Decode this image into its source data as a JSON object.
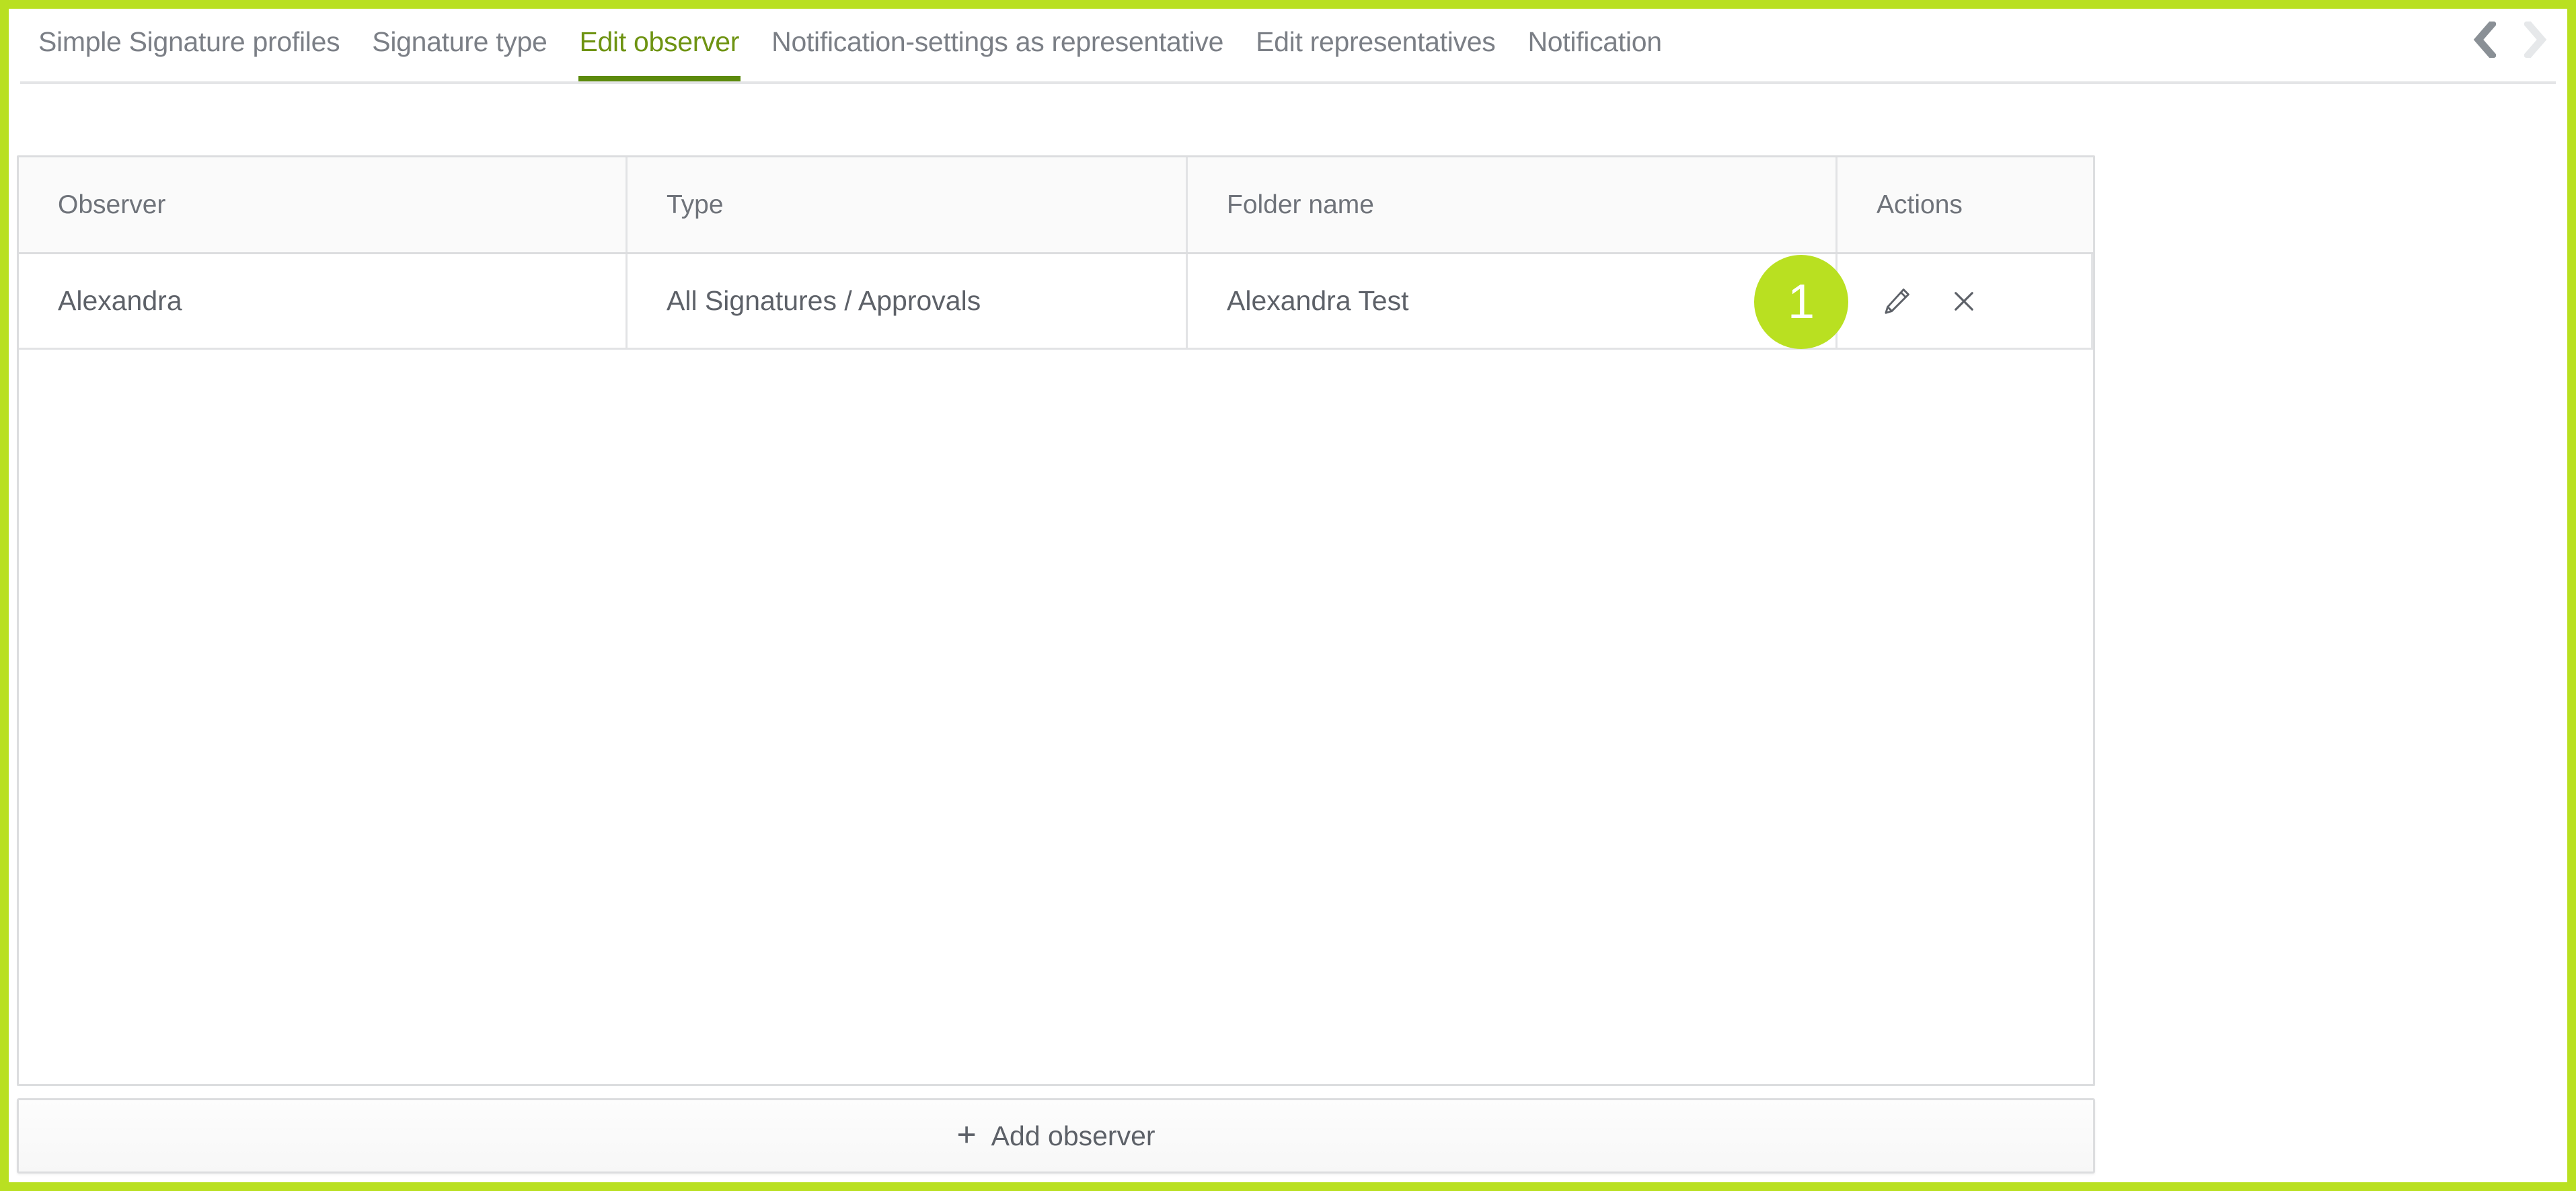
{
  "theme": {
    "frame_green": "#b9e021",
    "badge_green": "#b9e021",
    "active_tab_text": "#6e9312",
    "active_tab_underline": "#5c8a0c",
    "inactive_tab_text": "#7b7f86",
    "table_border": "#dcdddf",
    "header_bg": "#fafafa",
    "body_text": "#5d6168"
  },
  "tabs": [
    {
      "label": "Simple Signature profiles",
      "active": false
    },
    {
      "label": "Signature type",
      "active": false
    },
    {
      "label": "Edit observer",
      "active": true
    },
    {
      "label": "Notification-settings as representative",
      "active": false
    },
    {
      "label": "Edit representatives",
      "active": false
    },
    {
      "label": "Notification",
      "active": false
    }
  ],
  "tab_nav": {
    "prev_icon": "chevron-left-icon",
    "next_icon": "chevron-right-icon",
    "prev_enabled": true,
    "next_enabled": false
  },
  "table": {
    "columns": [
      {
        "key": "observer",
        "label": "Observer"
      },
      {
        "key": "type",
        "label": "Type"
      },
      {
        "key": "folder",
        "label": "Folder name"
      },
      {
        "key": "actions",
        "label": "Actions"
      }
    ],
    "rows": [
      {
        "observer": "Alexandra",
        "type": "All Signatures / Approvals",
        "folder": "Alexandra Test",
        "actions": [
          {
            "icon": "pencil-edit-icon",
            "title": "Edit"
          },
          {
            "icon": "close-x-icon",
            "title": "Delete"
          }
        ]
      }
    ]
  },
  "annotation": {
    "badge_number": "1"
  },
  "footer": {
    "add_observer_label": "Add observer",
    "add_observer_plus": "+"
  }
}
